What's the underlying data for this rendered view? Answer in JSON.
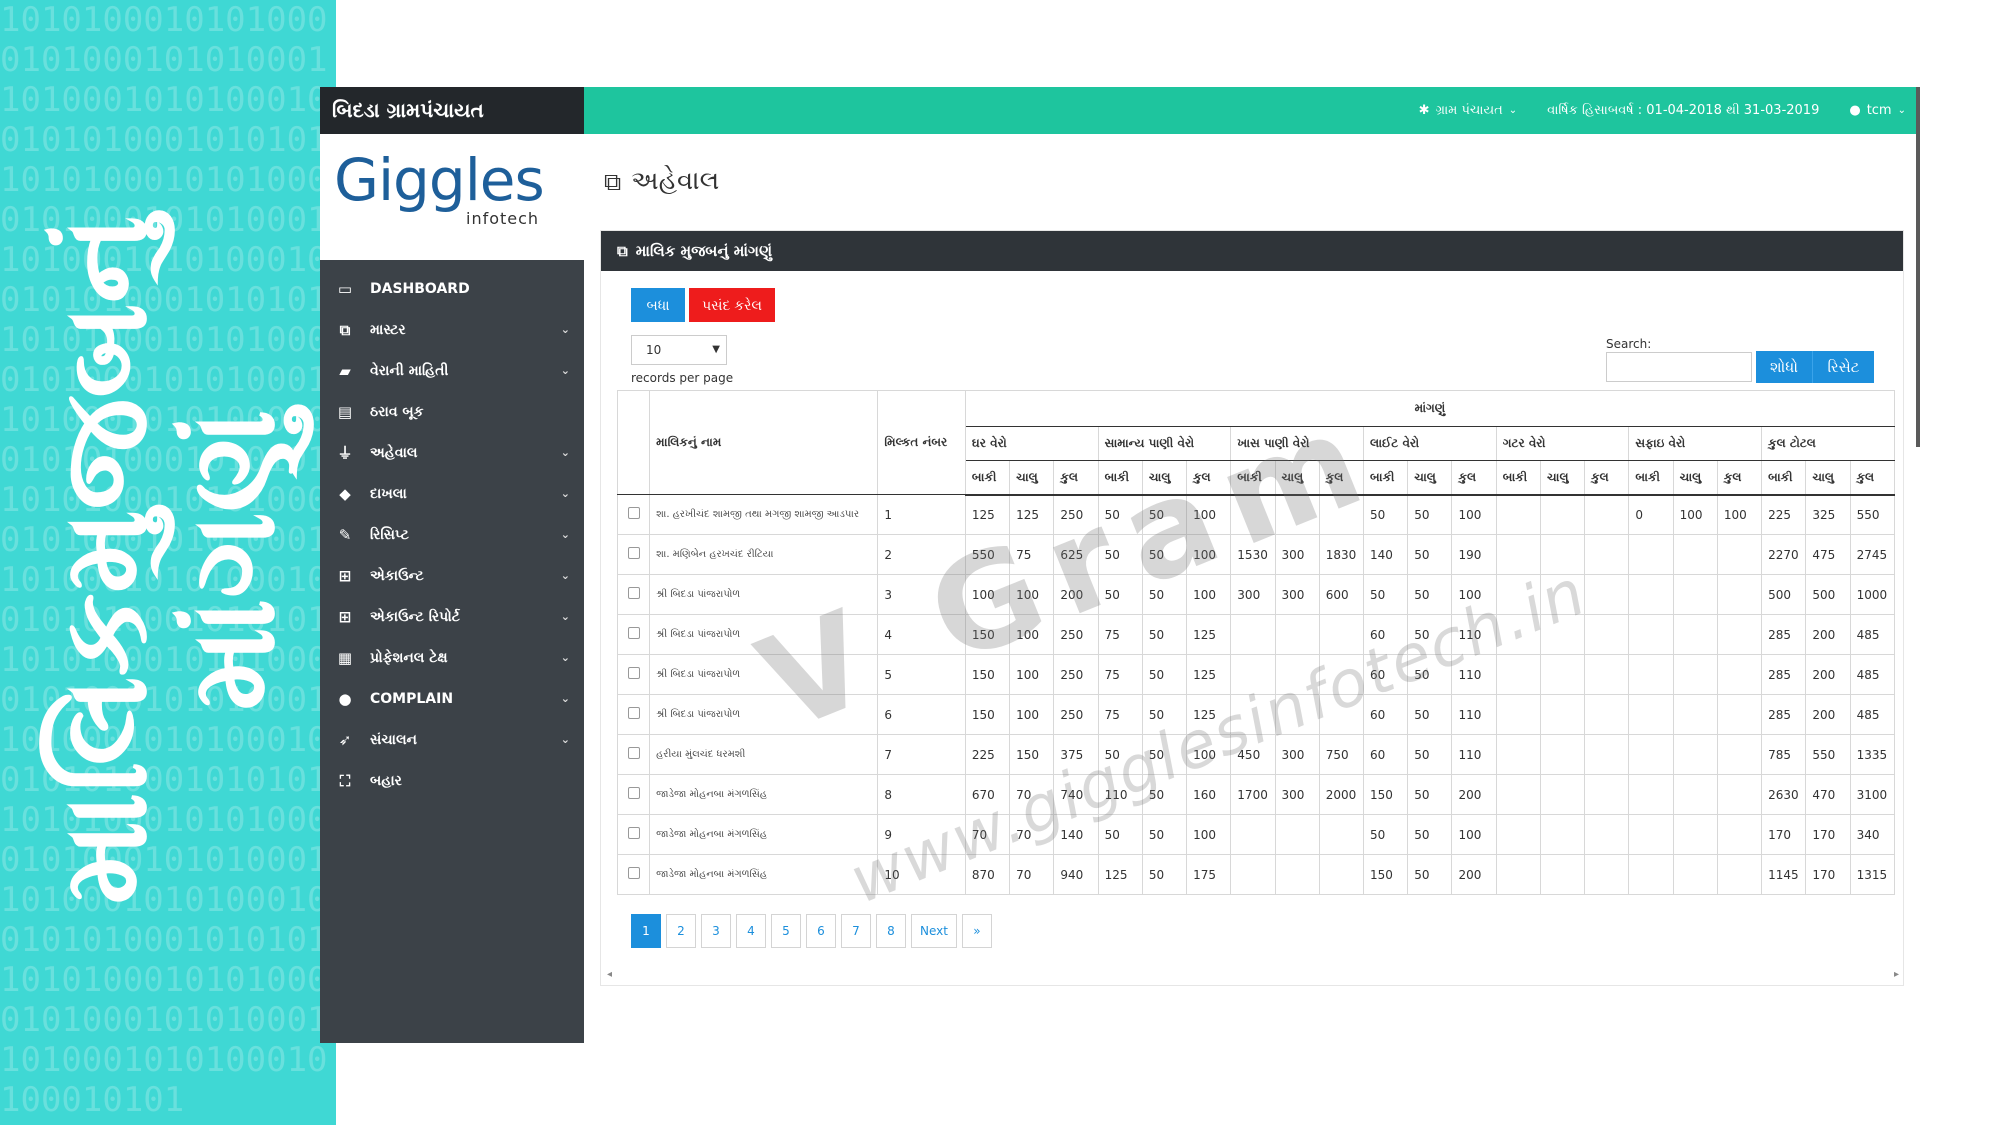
{
  "banner": {
    "lines": [
      "માલિકમુજબનું",
      "માંગણું"
    ],
    "binary_rows": [
      "1010100010101000",
      "0101000101010001",
      "1010001010100010",
      "0101010001010101",
      "1010100010101000",
      "0101000101010001",
      "1010001010100010",
      "0101010001010101",
      "1010100010101000",
      "0101000101010001",
      "1010001010100010",
      "0101010001010101",
      "1010100010101000",
      "0101000101010001",
      "1010001010100010",
      "0101010001010101",
      "1010100010101000",
      "0101000101010001",
      "1010001010100010",
      "0101010001010101",
      "1010100010101000",
      "0101000101010001",
      "1010001010100010",
      "0101010001010101",
      "1010100010101000",
      "0101000101010001",
      "1010001010100010",
      "100010101"
    ]
  },
  "sidebar": {
    "brand": "બિદડા ગ્રામપંચાયત",
    "logo_main": "Giggles",
    "logo_sub": "infotech",
    "items": [
      {
        "label": "DASHBOARD",
        "icon": "monitor-icon",
        "glyph": "▭",
        "chevron": false
      },
      {
        "label": "માસ્ટર",
        "icon": "copy-icon",
        "glyph": "⧉",
        "chevron": true
      },
      {
        "label": "વેરાની માહિતી",
        "icon": "folder-icon",
        "glyph": "▰",
        "chevron": true
      },
      {
        "label": "ઠરાવ બૂક",
        "icon": "book-icon",
        "glyph": "▤",
        "chevron": false
      },
      {
        "label": "અહેવાલ",
        "icon": "filter-icon",
        "glyph": "⏚",
        "chevron": true
      },
      {
        "label": "દાખલા",
        "icon": "tags-icon",
        "glyph": "◆",
        "chevron": true
      },
      {
        "label": "રિસિપ્ટ",
        "icon": "edit-icon",
        "glyph": "✎",
        "chevron": true
      },
      {
        "label": "એકાઉન્ટ",
        "icon": "plus-square-icon",
        "glyph": "⊞",
        "chevron": true
      },
      {
        "label": "એકાઉન્ટ રિપોર્ટ",
        "icon": "plus-square-icon",
        "glyph": "⊞",
        "chevron": true
      },
      {
        "label": "પ્રોફેશનલ ટેક્ષ",
        "icon": "calculator-icon",
        "glyph": "▦",
        "chevron": true
      },
      {
        "label": "COMPLAIN",
        "icon": "user-icon",
        "glyph": "●",
        "chevron": true
      },
      {
        "label": "સંચાલન",
        "icon": "rocket-icon",
        "glyph": "➶",
        "chevron": true
      },
      {
        "label": "બહાર",
        "icon": "sitemap-icon",
        "glyph": "⛶",
        "chevron": false
      }
    ]
  },
  "topbar": {
    "panchayat": "ગ્રામ પંચાયત",
    "fiscal_year": "વાર્ષિક હિસાબવર્ષ : 01-04-2018 થી 31-03-2019",
    "user": "tcm"
  },
  "page": {
    "title": "અહેવાલ",
    "panel_title": "માલિક મુજબનું માંગણું",
    "btn_all": "બધા",
    "btn_selected": "પસંદ કરેલ",
    "rpp_value": "10",
    "rpp_label": "records per page",
    "search_label": "Search:",
    "search_value": "",
    "btn_search": "શોધો",
    "btn_reset": "રિસેટ"
  },
  "table": {
    "demand_header": "માંગણું",
    "owner_header": "માલિકનું નામ",
    "property_header": "મિલ્કત નંબર",
    "groups": [
      "ઘર વેરો",
      "સામાન્ય પાણી વેરો",
      "ખાસ પાણી વેરો",
      "લાઈટ વેરો",
      "ગટર વેરો",
      "સફાઇ વેરો",
      "કુલ ટોટલ"
    ],
    "sub_headers": [
      "બાકી",
      "ચાલુ",
      "કુલ"
    ],
    "rows": [
      {
        "name": "શા. હરખીચંદ શામજી તથા મગજી શામજી આડપાર",
        "no": "1",
        "v": [
          "125",
          "125",
          "250",
          "50",
          "50",
          "100",
          "",
          "",
          "",
          "50",
          "50",
          "100",
          "",
          "",
          "",
          "0",
          "100",
          "100",
          "225",
          "325",
          "550"
        ]
      },
      {
        "name": "શા. મણિબેન હરખચંદ રીટિયા",
        "no": "2",
        "v": [
          "550",
          "75",
          "625",
          "50",
          "50",
          "100",
          "1530",
          "300",
          "1830",
          "140",
          "50",
          "190",
          "",
          "",
          "",
          "",
          "",
          "",
          "2270",
          "475",
          "2745"
        ]
      },
      {
        "name": "શ્રી બિદડા પાંજરાપોળ",
        "no": "3",
        "v": [
          "100",
          "100",
          "200",
          "50",
          "50",
          "100",
          "300",
          "300",
          "600",
          "50",
          "50",
          "100",
          "",
          "",
          "",
          "",
          "",
          "",
          "500",
          "500",
          "1000"
        ]
      },
      {
        "name": "શ્રી બિદડા પાંજરાપોળ",
        "no": "4",
        "v": [
          "150",
          "100",
          "250",
          "75",
          "50",
          "125",
          "",
          "",
          "",
          "60",
          "50",
          "110",
          "",
          "",
          "",
          "",
          "",
          "",
          "285",
          "200",
          "485"
        ]
      },
      {
        "name": "શ્રી બિદડા પાંજરાપોળ",
        "no": "5",
        "v": [
          "150",
          "100",
          "250",
          "75",
          "50",
          "125",
          "",
          "",
          "",
          "60",
          "50",
          "110",
          "",
          "",
          "",
          "",
          "",
          "",
          "285",
          "200",
          "485"
        ]
      },
      {
        "name": "શ્રી બિદડા પાંજરાપોળ",
        "no": "6",
        "v": [
          "150",
          "100",
          "250",
          "75",
          "50",
          "125",
          "",
          "",
          "",
          "60",
          "50",
          "110",
          "",
          "",
          "",
          "",
          "",
          "",
          "285",
          "200",
          "485"
        ]
      },
      {
        "name": "હરીયા મુંલચંદ ધરમશી",
        "no": "7",
        "v": [
          "225",
          "150",
          "375",
          "50",
          "50",
          "100",
          "450",
          "300",
          "750",
          "60",
          "50",
          "110",
          "",
          "",
          "",
          "",
          "",
          "",
          "785",
          "550",
          "1335"
        ]
      },
      {
        "name": "જાડેજા મોહનબા મંગળસિંહ",
        "no": "8",
        "v": [
          "670",
          "70",
          "740",
          "110",
          "50",
          "160",
          "1700",
          "300",
          "2000",
          "150",
          "50",
          "200",
          "",
          "",
          "",
          "",
          "",
          "",
          "2630",
          "470",
          "3100"
        ]
      },
      {
        "name": "જાડેજા મોહનબા મંગળસિંહ",
        "no": "9",
        "v": [
          "70",
          "70",
          "140",
          "50",
          "50",
          "100",
          "",
          "",
          "",
          "50",
          "50",
          "100",
          "",
          "",
          "",
          "",
          "",
          "",
          "170",
          "170",
          "340"
        ]
      },
      {
        "name": "જાડેજા મોહનબા મંગળસિંહ",
        "no": "10",
        "v": [
          "870",
          "70",
          "940",
          "125",
          "50",
          "175",
          "",
          "",
          "",
          "150",
          "50",
          "200",
          "",
          "",
          "",
          "",
          "",
          "",
          "1145",
          "170",
          "1315"
        ]
      }
    ]
  },
  "pagination": {
    "pages": [
      "1",
      "2",
      "3",
      "4",
      "5",
      "6",
      "7",
      "8"
    ],
    "active": "1",
    "next": "Next",
    "last": "»"
  },
  "watermark": {
    "brand": "V Gram",
    "url": "www.gigglesinfotech.in"
  },
  "colors": {
    "banner": "#3fd8d4",
    "topbar": "#1ec59e",
    "sidebar": "#3c4248",
    "primary_button": "#1c8fdc",
    "danger_button": "#ee1c1c"
  }
}
